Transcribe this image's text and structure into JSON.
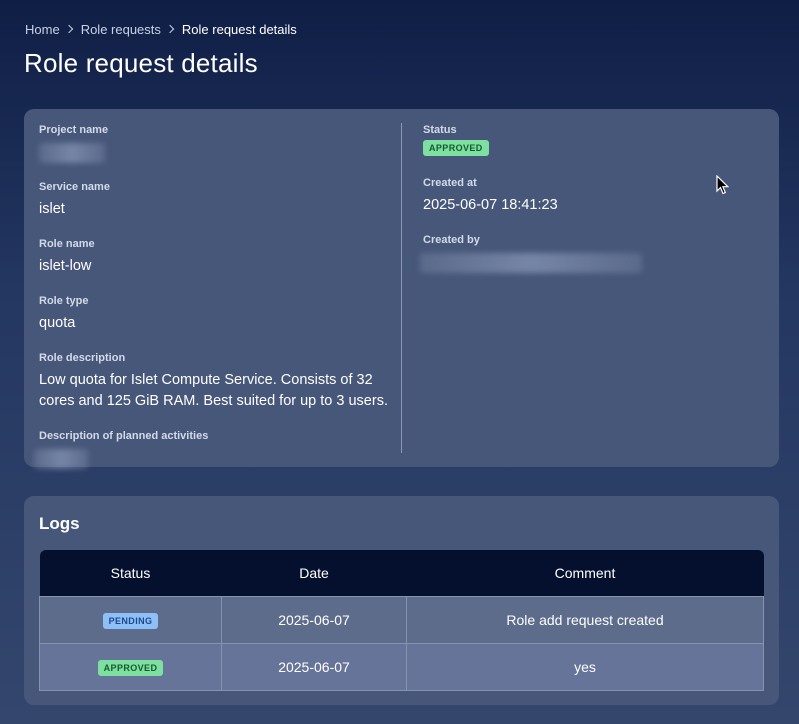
{
  "breadcrumb": {
    "items": [
      "Home",
      "Role requests",
      "Role request details"
    ]
  },
  "page": {
    "title": "Role request details"
  },
  "details": {
    "project_name": {
      "label": "Project name",
      "value": ""
    },
    "service_name": {
      "label": "Service name",
      "value": "islet"
    },
    "role_name": {
      "label": "Role name",
      "value": "islet-low"
    },
    "role_type": {
      "label": "Role type",
      "value": "quota"
    },
    "role_description": {
      "label": "Role description",
      "value": "Low quota for Islet Compute Service. Consists of 32 cores and 125 GiB RAM. Best suited for up to 3 users."
    },
    "planned_activities": {
      "label": "Description of planned activities",
      "value": ""
    },
    "status": {
      "label": "Status",
      "value": "APPROVED"
    },
    "created_at": {
      "label": "Created at",
      "value": "2025-06-07 18:41:23"
    },
    "created_by": {
      "label": "Created by",
      "value": ""
    }
  },
  "logs": {
    "title": "Logs",
    "columns": [
      "Status",
      "Date",
      "Comment"
    ],
    "rows": [
      {
        "status": "PENDING",
        "date": "2025-06-07",
        "comment": "Role add request created"
      },
      {
        "status": "APPROVED",
        "date": "2025-06-07",
        "comment": "yes"
      }
    ]
  },
  "colors": {
    "approved_badge": "#7ee0a0",
    "pending_badge": "#8ec0f7",
    "table_header": "#04102d"
  }
}
